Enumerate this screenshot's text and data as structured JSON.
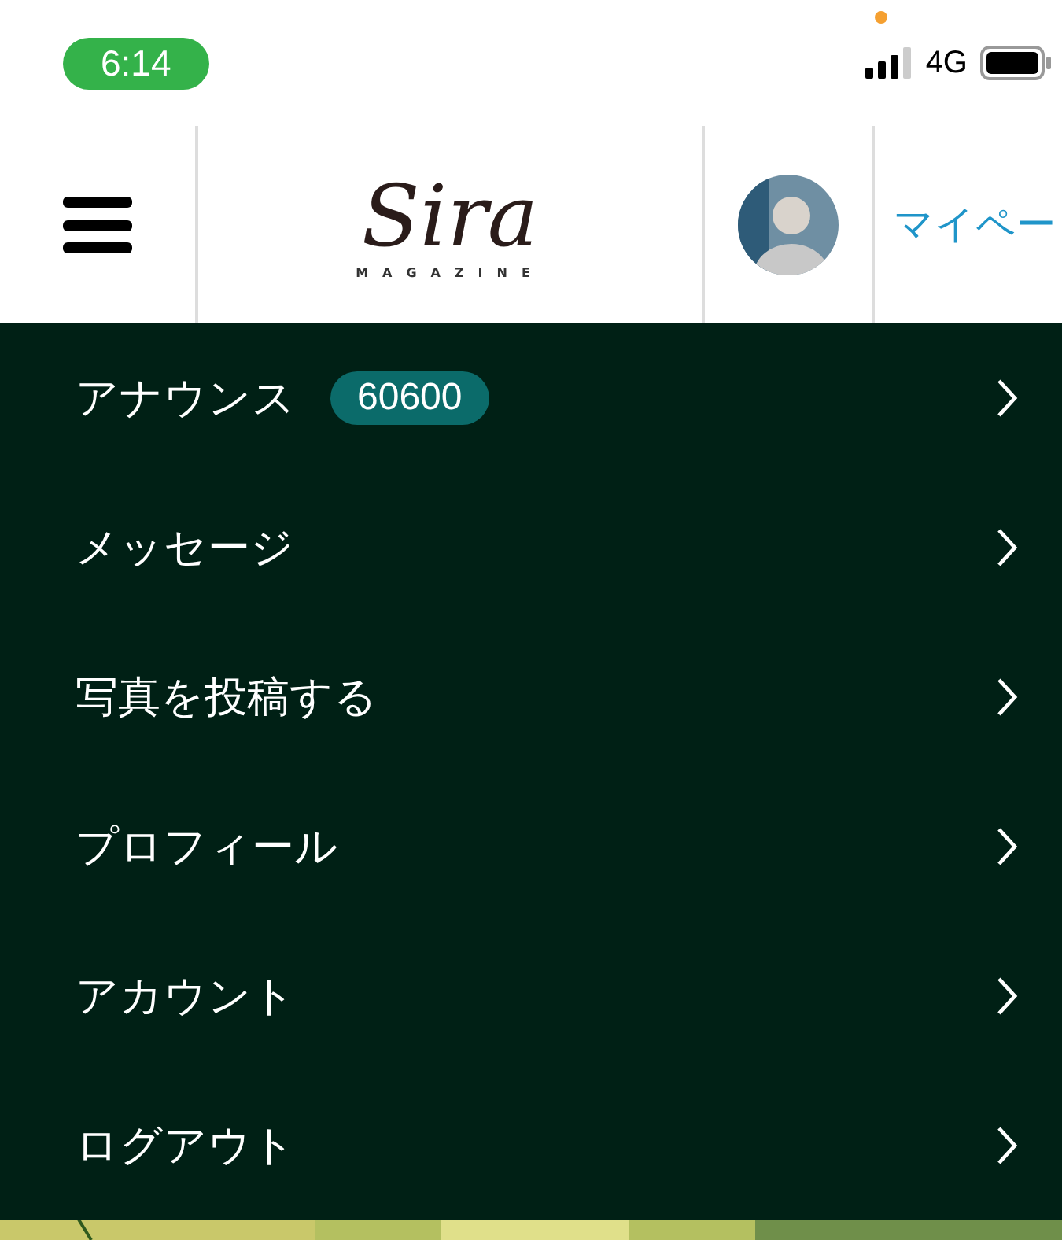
{
  "status_bar": {
    "time": "6:14",
    "network": "4G"
  },
  "header": {
    "logo": "Sira",
    "logo_subtitle": "MAGAZINE",
    "my_page_link": "マイペー"
  },
  "menu": [
    {
      "label": "アナウンス",
      "badge": "60600"
    },
    {
      "label": "メッセージ"
    },
    {
      "label": "写真を投稿する"
    },
    {
      "label": "プロフィール"
    },
    {
      "label": "アカウント"
    },
    {
      "label": "ログアウト"
    }
  ]
}
